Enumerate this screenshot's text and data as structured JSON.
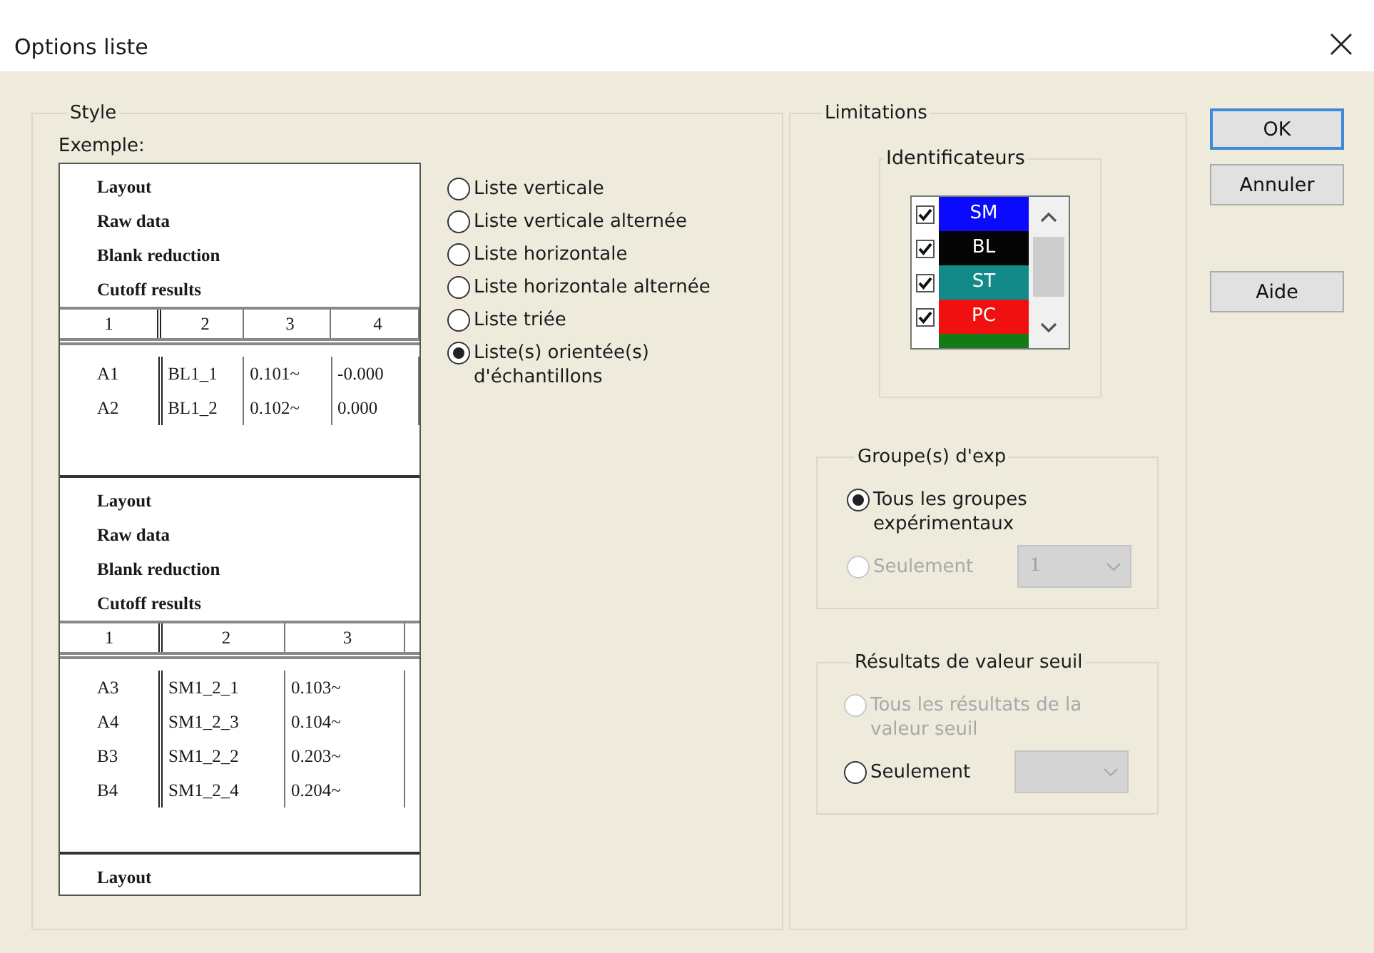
{
  "window": {
    "title": "Options liste"
  },
  "style": {
    "title": "Style",
    "example_label": "Exemple:",
    "preview": {
      "sections": [
        {
          "headings": [
            "Layout",
            "Raw data",
            "Blank reduction",
            "Cutoff results"
          ],
          "columns": [
            "1",
            "2",
            "3",
            "4"
          ],
          "rows": [
            [
              "A1",
              "BL1_1",
              "0.101~",
              "-0.000"
            ],
            [
              "A2",
              "BL1_2",
              "0.102~",
              "0.000"
            ]
          ]
        },
        {
          "headings": [
            "Layout",
            "Raw data",
            "Blank reduction",
            "Cutoff results"
          ],
          "columns": [
            "1",
            "2",
            "3"
          ],
          "rows": [
            [
              "A3",
              "SM1_2_1",
              "0.103~"
            ],
            [
              "A4",
              "SM1_2_3",
              "0.104~"
            ],
            [
              "B3",
              "SM1_2_2",
              "0.203~"
            ],
            [
              "B4",
              "SM1_2_4",
              "0.204~"
            ]
          ]
        },
        {
          "headings": [
            "Layout"
          ]
        }
      ]
    },
    "options": [
      {
        "label": "Liste verticale",
        "selected": false
      },
      {
        "label": "Liste verticale alternée",
        "selected": false
      },
      {
        "label": "Liste horizontale",
        "selected": false
      },
      {
        "label": "Liste horizontale alternée",
        "selected": false
      },
      {
        "label": "Liste triée",
        "selected": false
      },
      {
        "label": "Liste(s) orientée(s) d'échantillons",
        "selected": true
      }
    ]
  },
  "limitations": {
    "title": "Limitations",
    "identifiers": {
      "title": "Identificateurs",
      "items": [
        {
          "label": "SM",
          "checked": true,
          "color": "#0a0aff"
        },
        {
          "label": "BL",
          "checked": true,
          "color": "#050505"
        },
        {
          "label": "ST",
          "checked": true,
          "color": "#138a8a"
        },
        {
          "label": "PC",
          "checked": true,
          "color": "#f01010"
        },
        {
          "color": "#157a15"
        }
      ]
    },
    "groups": {
      "title": "Groupe(s) d'exp",
      "options": [
        {
          "label": "Tous les groupes expérimentaux",
          "selected": true,
          "disabled": false
        },
        {
          "label": "Seulement",
          "selected": false,
          "disabled": true
        }
      ],
      "dropdown": {
        "value": "1",
        "disabled": true
      }
    },
    "cutoff": {
      "title": "Résultats de valeur seuil",
      "options": [
        {
          "label": "Tous les résultats de la valeur seuil",
          "selected": false,
          "disabled": true
        },
        {
          "label": "Seulement",
          "selected": false,
          "disabled": false
        }
      ],
      "dropdown": {
        "disabled": true
      }
    }
  },
  "buttons": [
    {
      "label": "OK",
      "default": true
    },
    {
      "label": "Annuler",
      "default": false
    },
    {
      "label": "Aide",
      "default": false
    }
  ]
}
